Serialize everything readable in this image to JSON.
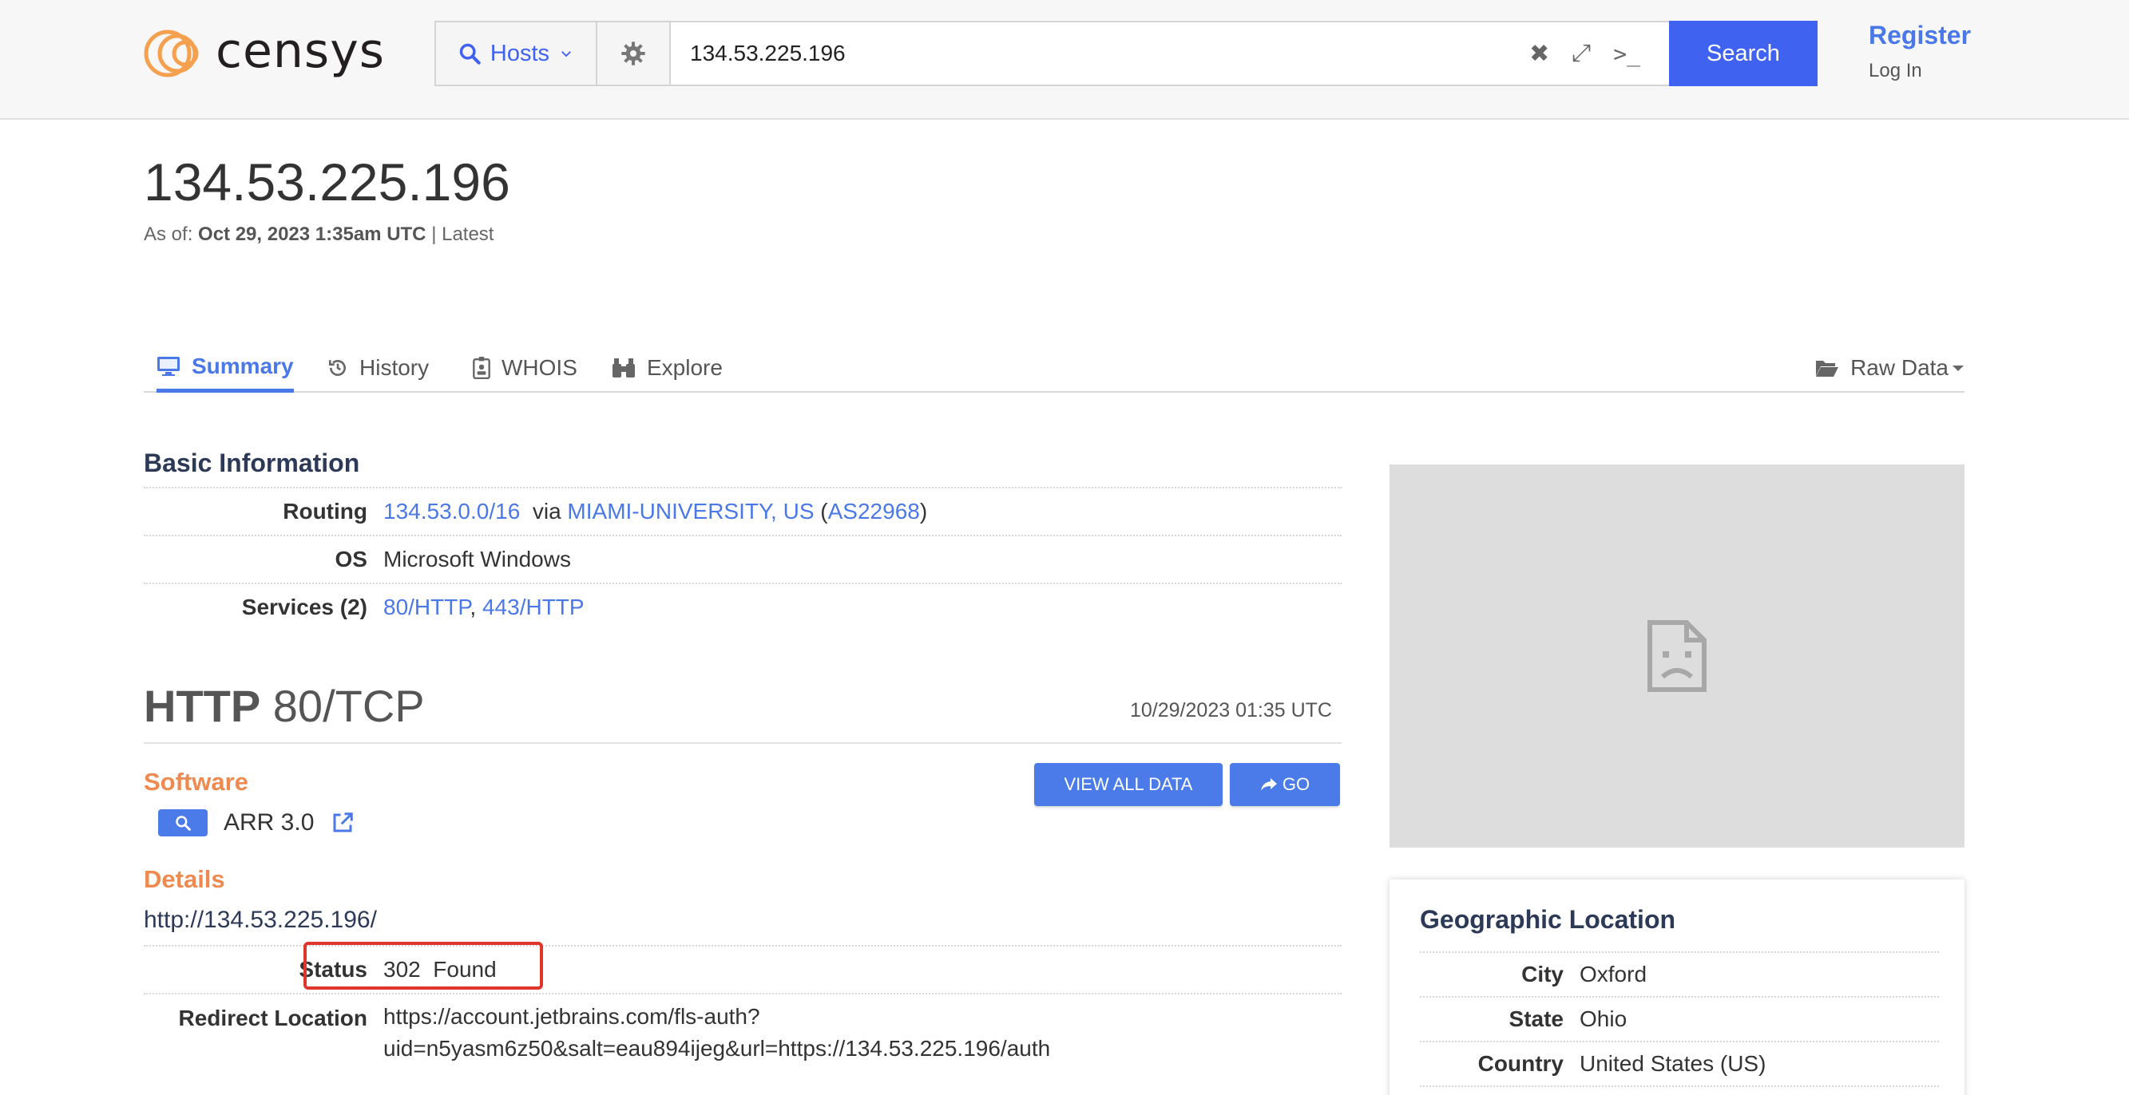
{
  "header": {
    "logo_text": "censys",
    "search_type": "Hosts",
    "query": "134.53.225.196",
    "search_button": "Search",
    "register": "Register",
    "login": "Log In"
  },
  "host": {
    "ip": "134.53.225.196",
    "as_of_label": "As of:",
    "as_of_date": "Oct 29, 2023 1:35am UTC",
    "as_of_suffix": "| Latest"
  },
  "tabs": [
    {
      "label": "Summary",
      "icon": "monitor-icon",
      "active": true
    },
    {
      "label": "History",
      "icon": "history-icon"
    },
    {
      "label": "WHOIS",
      "icon": "id-badge-icon"
    },
    {
      "label": "Explore",
      "icon": "binoculars-icon"
    }
  ],
  "raw_data": "Raw Data",
  "basic_info": {
    "title": "Basic Information",
    "routing_label": "Routing",
    "routing_prefix": "134.53.0.0/16",
    "routing_via": "via",
    "routing_org": "MIAMI-UNIVERSITY, US",
    "routing_asn": "AS22968",
    "os_label": "OS",
    "os_value": "Microsoft Windows",
    "services_label": "Services (2)",
    "service_1": "80/HTTP",
    "service_2": "443/HTTP"
  },
  "http": {
    "protocol": "HTTP",
    "port": "80/TCP",
    "timestamp": "10/29/2023 01:35 UTC",
    "software_title": "Software",
    "view_all": "VIEW ALL DATA",
    "go": "GO",
    "software_name": "ARR 3.0",
    "details_title": "Details",
    "url": "http://134.53.225.196/",
    "status_label": "Status",
    "status_value": "302  Found",
    "redirect_label": "Redirect Location",
    "redirect_line1": "https://account.jetbrains.com/fls-auth?",
    "redirect_line2": "uid=n5yasm6z50&salt=eau894ijeg&url=https://134.53.225.196/auth"
  },
  "geo": {
    "title": "Geographic Location",
    "city_label": "City",
    "city": "Oxford",
    "state_label": "State",
    "state": "Ohio",
    "country_label": "Country",
    "country": "United States (US)"
  },
  "colors": {
    "accent": "#3f63f0",
    "link": "#4a78e8",
    "section_orange": "#ee8a4f",
    "highlight_box": "#e0352b"
  }
}
